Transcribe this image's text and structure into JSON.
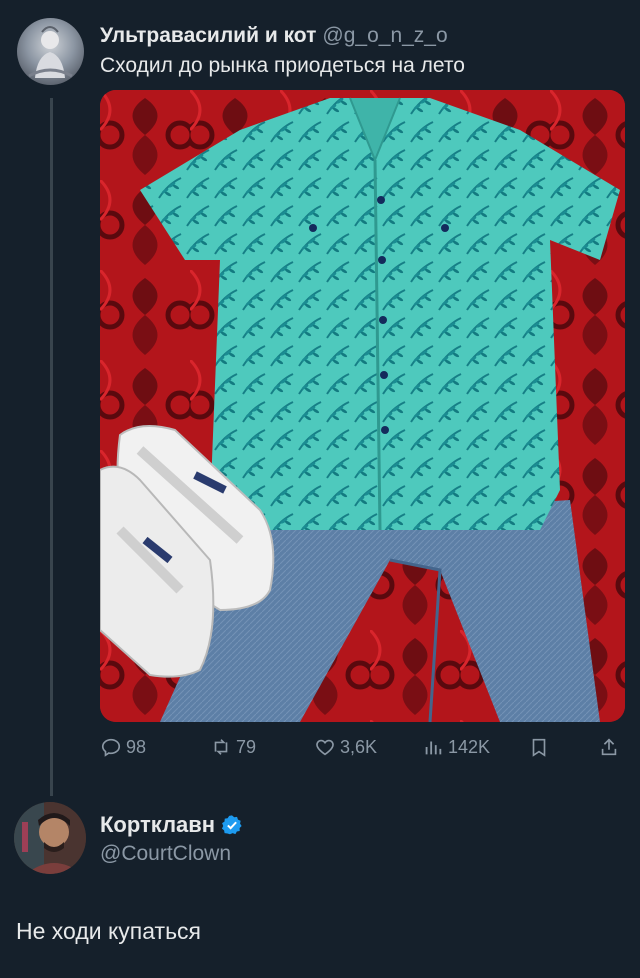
{
  "tweet1": {
    "name": "Ультравасилий и кот",
    "handle": "@g_o_n_z_o",
    "text": "Сходил до рынка приодеться на лето",
    "image_alt": "teal leaf-print shirt, blue jeans and white sneakers on red patterned carpet",
    "actions": {
      "replies": "98",
      "retweets": "79",
      "likes": "3,6K",
      "views": "142K"
    }
  },
  "tweet2": {
    "name": "Кортклавн",
    "handle": "@CourtClown",
    "text": "Не ходи купаться"
  },
  "colors": {
    "background": "#15202b",
    "text": "#e7e9ea",
    "muted": "#8b98a5",
    "verified": "#1d9bf0"
  }
}
